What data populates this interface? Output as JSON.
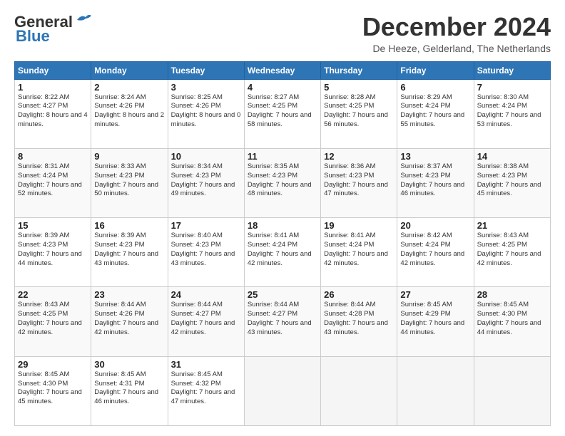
{
  "header": {
    "logo_line1": "General",
    "logo_line2": "Blue",
    "month": "December 2024",
    "location": "De Heeze, Gelderland, The Netherlands"
  },
  "weekdays": [
    "Sunday",
    "Monday",
    "Tuesday",
    "Wednesday",
    "Thursday",
    "Friday",
    "Saturday"
  ],
  "weeks": [
    [
      {
        "day": "1",
        "rise": "8:22 AM",
        "set": "4:27 PM",
        "daylight": "8 hours and 4 minutes"
      },
      {
        "day": "2",
        "rise": "8:24 AM",
        "set": "4:26 PM",
        "daylight": "8 hours and 2 minutes"
      },
      {
        "day": "3",
        "rise": "8:25 AM",
        "set": "4:26 PM",
        "daylight": "8 hours and 0 minutes"
      },
      {
        "day": "4",
        "rise": "8:27 AM",
        "set": "4:25 PM",
        "daylight": "7 hours and 58 minutes"
      },
      {
        "day": "5",
        "rise": "8:28 AM",
        "set": "4:25 PM",
        "daylight": "7 hours and 56 minutes"
      },
      {
        "day": "6",
        "rise": "8:29 AM",
        "set": "4:24 PM",
        "daylight": "7 hours and 55 minutes"
      },
      {
        "day": "7",
        "rise": "8:30 AM",
        "set": "4:24 PM",
        "daylight": "7 hours and 53 minutes"
      }
    ],
    [
      {
        "day": "8",
        "rise": "8:31 AM",
        "set": "4:24 PM",
        "daylight": "7 hours and 52 minutes"
      },
      {
        "day": "9",
        "rise": "8:33 AM",
        "set": "4:23 PM",
        "daylight": "7 hours and 50 minutes"
      },
      {
        "day": "10",
        "rise": "8:34 AM",
        "set": "4:23 PM",
        "daylight": "7 hours and 49 minutes"
      },
      {
        "day": "11",
        "rise": "8:35 AM",
        "set": "4:23 PM",
        "daylight": "7 hours and 48 minutes"
      },
      {
        "day": "12",
        "rise": "8:36 AM",
        "set": "4:23 PM",
        "daylight": "7 hours and 47 minutes"
      },
      {
        "day": "13",
        "rise": "8:37 AM",
        "set": "4:23 PM",
        "daylight": "7 hours and 46 minutes"
      },
      {
        "day": "14",
        "rise": "8:38 AM",
        "set": "4:23 PM",
        "daylight": "7 hours and 45 minutes"
      }
    ],
    [
      {
        "day": "15",
        "rise": "8:39 AM",
        "set": "4:23 PM",
        "daylight": "7 hours and 44 minutes"
      },
      {
        "day": "16",
        "rise": "8:39 AM",
        "set": "4:23 PM",
        "daylight": "7 hours and 43 minutes"
      },
      {
        "day": "17",
        "rise": "8:40 AM",
        "set": "4:23 PM",
        "daylight": "7 hours and 43 minutes"
      },
      {
        "day": "18",
        "rise": "8:41 AM",
        "set": "4:24 PM",
        "daylight": "7 hours and 42 minutes"
      },
      {
        "day": "19",
        "rise": "8:41 AM",
        "set": "4:24 PM",
        "daylight": "7 hours and 42 minutes"
      },
      {
        "day": "20",
        "rise": "8:42 AM",
        "set": "4:24 PM",
        "daylight": "7 hours and 42 minutes"
      },
      {
        "day": "21",
        "rise": "8:43 AM",
        "set": "4:25 PM",
        "daylight": "7 hours and 42 minutes"
      }
    ],
    [
      {
        "day": "22",
        "rise": "8:43 AM",
        "set": "4:25 PM",
        "daylight": "7 hours and 42 minutes"
      },
      {
        "day": "23",
        "rise": "8:44 AM",
        "set": "4:26 PM",
        "daylight": "7 hours and 42 minutes"
      },
      {
        "day": "24",
        "rise": "8:44 AM",
        "set": "4:27 PM",
        "daylight": "7 hours and 42 minutes"
      },
      {
        "day": "25",
        "rise": "8:44 AM",
        "set": "4:27 PM",
        "daylight": "7 hours and 43 minutes"
      },
      {
        "day": "26",
        "rise": "8:44 AM",
        "set": "4:28 PM",
        "daylight": "7 hours and 43 minutes"
      },
      {
        "day": "27",
        "rise": "8:45 AM",
        "set": "4:29 PM",
        "daylight": "7 hours and 44 minutes"
      },
      {
        "day": "28",
        "rise": "8:45 AM",
        "set": "4:30 PM",
        "daylight": "7 hours and 44 minutes"
      }
    ],
    [
      {
        "day": "29",
        "rise": "8:45 AM",
        "set": "4:30 PM",
        "daylight": "7 hours and 45 minutes"
      },
      {
        "day": "30",
        "rise": "8:45 AM",
        "set": "4:31 PM",
        "daylight": "7 hours and 46 minutes"
      },
      {
        "day": "31",
        "rise": "8:45 AM",
        "set": "4:32 PM",
        "daylight": "7 hours and 47 minutes"
      },
      null,
      null,
      null,
      null
    ]
  ]
}
